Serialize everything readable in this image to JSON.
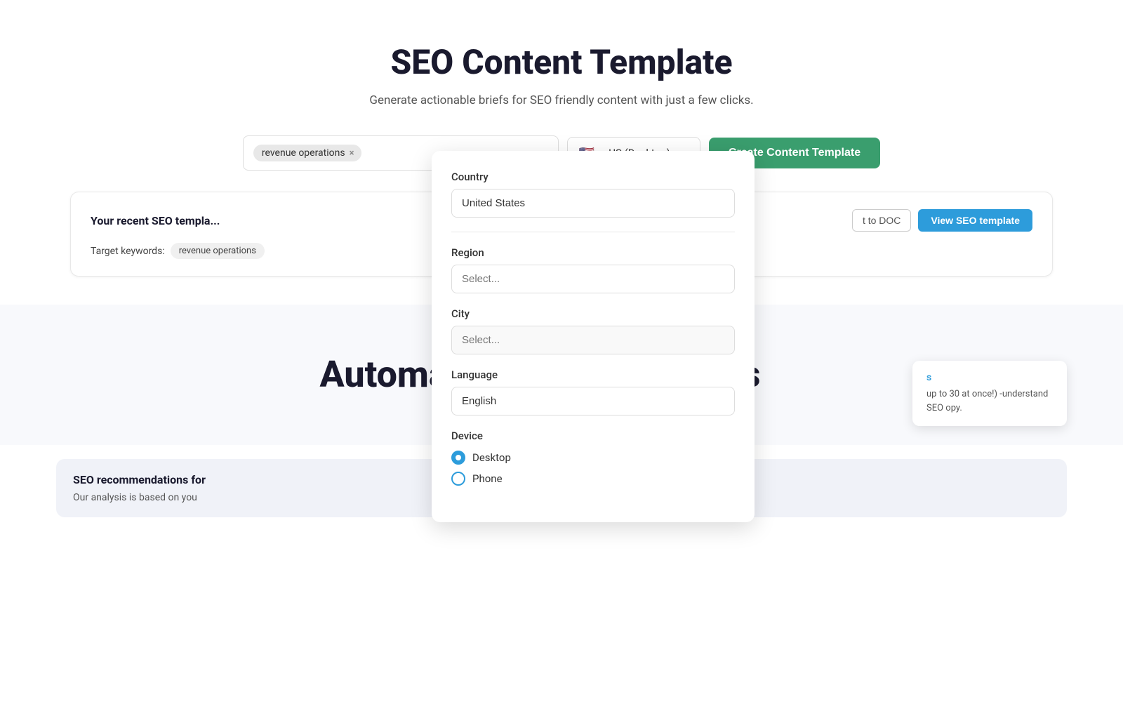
{
  "page": {
    "title": "SEO Content Template",
    "subtitle": "Generate actionable briefs for SEO friendly content with just a few clicks."
  },
  "search": {
    "keyword_tag": "revenue operations",
    "keyword_tag_close": "×",
    "location_label": "US (Desktop)",
    "flag": "🇺🇸",
    "create_button_label": "Create Content Template"
  },
  "recent": {
    "title": "Your recent SEO templa...",
    "keywords_label": "Target keywords:",
    "keyword_pill": "revenue operations",
    "export_button_label": "t to DOC",
    "view_button_label": "View SEO template"
  },
  "automate": {
    "left_text": "Automate",
    "right_text": "Content Briefs"
  },
  "info_card": {
    "link_text": "s",
    "text": "up to 30 at once!)\n-understand SEO\nopy."
  },
  "seo_card": {
    "title": "SEO recommendations for",
    "text": "Our analysis is based on you"
  },
  "dropdown": {
    "country_label": "Country",
    "country_value": "United States",
    "region_label": "Region",
    "region_placeholder": "Select...",
    "city_label": "City",
    "city_placeholder": "Select...",
    "language_label": "Language",
    "language_value": "English",
    "device_label": "Device",
    "device_options": [
      {
        "label": "Desktop",
        "checked": true
      },
      {
        "label": "Phone",
        "checked": false
      }
    ]
  }
}
